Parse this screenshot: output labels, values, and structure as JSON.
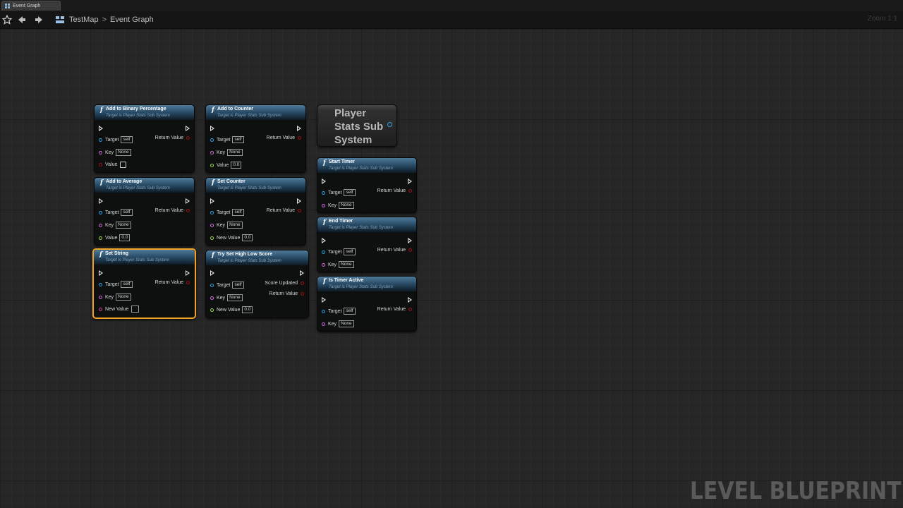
{
  "tab": {
    "label": "Event Graph"
  },
  "toolbar": {
    "breadcrumb": [
      "TestMap",
      "Event Graph"
    ],
    "separator": ">",
    "zoom": "Zoom 1:1"
  },
  "watermark": "LEVEL BLUEPRINT",
  "subtitle": "Target is Player Stats Sub System",
  "pins": {
    "target": "Target",
    "self": "self",
    "key": "Key",
    "none": "None",
    "value": "Value",
    "new_value": "New Value",
    "return_value": "Return Value",
    "score_updated": "Score Updated",
    "zero": "0.0"
  },
  "nodes": {
    "add_binary": {
      "title": "Add to Binary Percentage"
    },
    "add_counter": {
      "title": "Add to Counter"
    },
    "add_average": {
      "title": "Add to Average"
    },
    "set_counter": {
      "title": "Set Counter"
    },
    "set_string": {
      "title": "Set String"
    },
    "try_set_hl": {
      "title": "Try Set High Low Score"
    },
    "start_timer": {
      "title": "Start Timer"
    },
    "end_timer": {
      "title": "End Timer"
    },
    "is_timer_active": {
      "title": "Is Timer Active"
    }
  },
  "variable_node": {
    "label": "Player Stats Sub System"
  },
  "colors": {
    "object_pin": "#2fa4e8",
    "name_pin": "#d46de0",
    "bool_pin": "#a01010",
    "float_pin": "#9bd94b",
    "string_pin": "#e23ea8",
    "selection": "#f2a323"
  }
}
